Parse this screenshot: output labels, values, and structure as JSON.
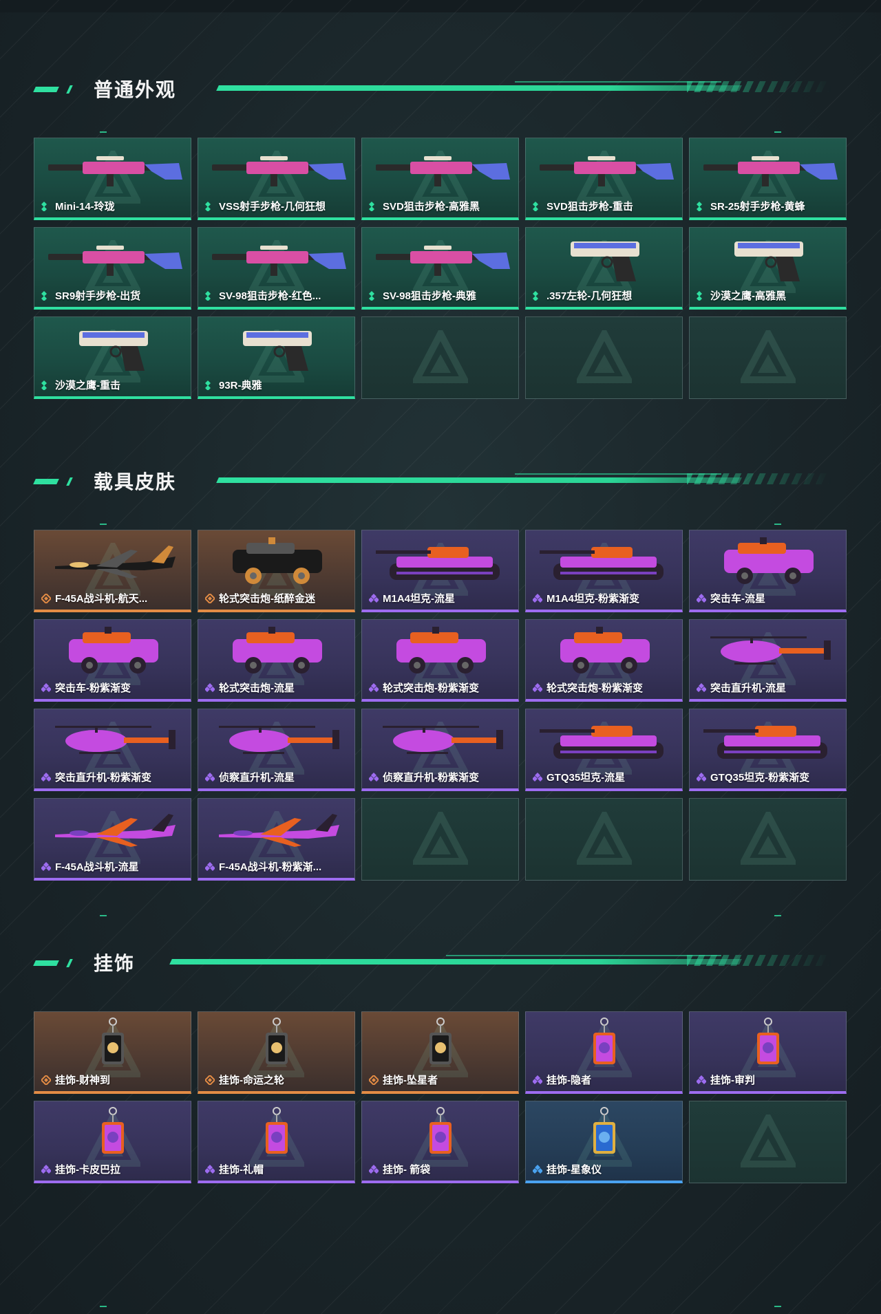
{
  "sections": [
    {
      "title": "普通外观",
      "items": [
        {
          "label": "Mini-14-玲珑",
          "rarity": "green",
          "art": "rifle"
        },
        {
          "label": "VSS射手步枪-几何狂想",
          "rarity": "green",
          "art": "rifle"
        },
        {
          "label": "SVD狙击步枪-高雅黑",
          "rarity": "green",
          "art": "rifle"
        },
        {
          "label": "SVD狙击步枪-重击",
          "rarity": "green",
          "art": "rifle"
        },
        {
          "label": "SR-25射手步枪-黄蜂",
          "rarity": "green",
          "art": "rifle"
        },
        {
          "label": "SR9射手步枪-出货",
          "rarity": "green",
          "art": "rifle"
        },
        {
          "label": "SV-98狙击步枪-红色...",
          "rarity": "green",
          "art": "rifle"
        },
        {
          "label": "SV-98狙击步枪-典雅",
          "rarity": "green",
          "art": "rifle"
        },
        {
          "label": ".357左轮-几何狂想",
          "rarity": "green",
          "art": "pistol"
        },
        {
          "label": "沙漠之鹰-高雅黑",
          "rarity": "green",
          "art": "pistol"
        },
        {
          "label": "沙漠之鹰-重击",
          "rarity": "green",
          "art": "pistol"
        },
        {
          "label": "93R-典雅",
          "rarity": "green",
          "art": "pistol"
        },
        {
          "label": "",
          "rarity": "empty",
          "art": ""
        },
        {
          "label": "",
          "rarity": "empty",
          "art": ""
        },
        {
          "label": "",
          "rarity": "empty",
          "art": ""
        }
      ]
    },
    {
      "title": "载具皮肤",
      "items": [
        {
          "label": "F-45A战斗机-航天...",
          "rarity": "orange",
          "art": "jet"
        },
        {
          "label": "轮式突击炮-纸醉金迷",
          "rarity": "orange",
          "art": "car"
        },
        {
          "label": "M1A4坦克-流星",
          "rarity": "purple",
          "art": "tank"
        },
        {
          "label": "M1A4坦克-粉紫渐变",
          "rarity": "purple",
          "art": "tank"
        },
        {
          "label": "突击车-流星",
          "rarity": "purple",
          "art": "car"
        },
        {
          "label": "突击车-粉紫渐变",
          "rarity": "purple",
          "art": "car"
        },
        {
          "label": "轮式突击炮-流星",
          "rarity": "purple",
          "art": "car"
        },
        {
          "label": "轮式突击炮-粉紫渐变",
          "rarity": "purple",
          "art": "car"
        },
        {
          "label": "轮式突击炮-粉紫渐变",
          "rarity": "purple",
          "art": "car"
        },
        {
          "label": "突击直升机-流星",
          "rarity": "purple",
          "art": "heli"
        },
        {
          "label": "突击直升机-粉紫渐变",
          "rarity": "purple",
          "art": "heli"
        },
        {
          "label": "侦察直升机-流星",
          "rarity": "purple",
          "art": "heli"
        },
        {
          "label": "侦察直升机-粉紫渐变",
          "rarity": "purple",
          "art": "heli"
        },
        {
          "label": "GTQ35坦克-流星",
          "rarity": "purple",
          "art": "tank"
        },
        {
          "label": "GTQ35坦克-粉紫渐变",
          "rarity": "purple",
          "art": "tank"
        },
        {
          "label": "F-45A战斗机-流星",
          "rarity": "purple",
          "art": "jet"
        },
        {
          "label": "F-45A战斗机-粉紫渐...",
          "rarity": "purple",
          "art": "jet"
        },
        {
          "label": "",
          "rarity": "empty",
          "art": ""
        },
        {
          "label": "",
          "rarity": "empty",
          "art": ""
        },
        {
          "label": "",
          "rarity": "empty",
          "art": ""
        }
      ]
    },
    {
      "title": "挂饰",
      "items": [
        {
          "label": "挂饰-财神到",
          "rarity": "orange",
          "art": "charm"
        },
        {
          "label": "挂饰-命运之轮",
          "rarity": "orange",
          "art": "charm"
        },
        {
          "label": "挂饰-坠星者",
          "rarity": "orange",
          "art": "charm"
        },
        {
          "label": "挂饰-隐者",
          "rarity": "purple",
          "art": "charm"
        },
        {
          "label": "挂饰-审判",
          "rarity": "purple",
          "art": "charm"
        },
        {
          "label": "挂饰-卡皮巴拉",
          "rarity": "purple",
          "art": "charm"
        },
        {
          "label": "挂饰-礼帽",
          "rarity": "purple",
          "art": "charm"
        },
        {
          "label": "挂饰- 箭袋",
          "rarity": "purple",
          "art": "charm"
        },
        {
          "label": "挂饰-星象仪",
          "rarity": "blue",
          "art": "charm"
        },
        {
          "label": "",
          "rarity": "empty",
          "art": ""
        }
      ]
    }
  ],
  "colors": {
    "accent": "#2fe0a0",
    "green": "#2fe0a0",
    "orange": "#e38c45",
    "purple": "#9d6cf0",
    "blue": "#4aa2f0"
  }
}
